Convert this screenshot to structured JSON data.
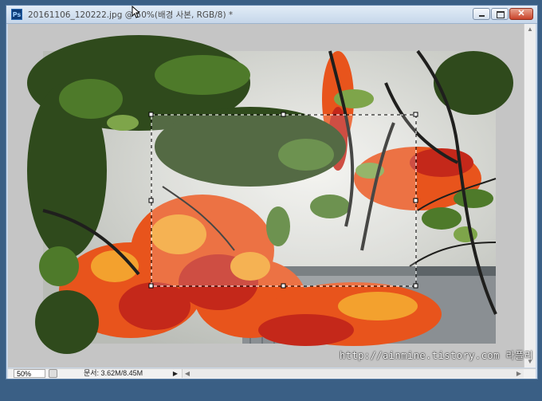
{
  "window": {
    "app_icon_label": "Ps",
    "title": "20161106_120222.jpg @ 50%(배경 사본, RGB/8) *",
    "controls": {
      "minimize": "minimize",
      "restore": "restore",
      "close": "✕"
    }
  },
  "status": {
    "zoom": "50%",
    "doc_info": "문서: 3.62M/8.45M",
    "menu_arrow": "▶"
  },
  "scroll": {
    "up": "▲",
    "down": "▼",
    "left": "◀",
    "right": "▶"
  },
  "watermark": "http://ainmine.tistory.com 라플리",
  "colors": {
    "canvas_gray": "#c5c5c5",
    "close_red": "#c9432a",
    "foliage_orange": "#e8541c",
    "foliage_green": "#2f4a1c"
  }
}
